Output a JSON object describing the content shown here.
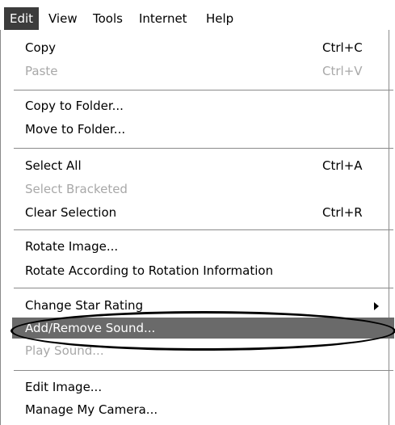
{
  "menubar": {
    "items": [
      "Edit",
      "View",
      "Tools",
      "Internet",
      "Help"
    ],
    "active": "Edit"
  },
  "menu": {
    "copy": {
      "label": "Copy",
      "shortcut": "Ctrl+C"
    },
    "paste": {
      "label": "Paste",
      "shortcut": "Ctrl+V"
    },
    "copy_to_folder": {
      "label": "Copy to Folder..."
    },
    "move_to_folder": {
      "label": "Move to Folder..."
    },
    "select_all": {
      "label": "Select All",
      "shortcut": "Ctrl+A"
    },
    "select_bracketed": {
      "label": "Select Bracketed"
    },
    "clear_selection": {
      "label": "Clear Selection",
      "shortcut": "Ctrl+R"
    },
    "rotate_image": {
      "label": "Rotate Image..."
    },
    "rotate_by_info": {
      "label": "Rotate According to Rotation Information"
    },
    "change_star_rating": {
      "label": "Change Star Rating"
    },
    "add_remove_sound": {
      "label": "Add/Remove Sound..."
    },
    "play_sound": {
      "label": "Play Sound..."
    },
    "edit_image": {
      "label": "Edit Image..."
    },
    "manage_camera": {
      "label": "Manage My Camera..."
    }
  },
  "icons": {
    "submenu_arrow": "chevron-right-icon",
    "highlight_callout": "oval-callout"
  },
  "colors": {
    "active_menu_bg": "#3c3c3c",
    "highlight_bg": "#6a6a6a",
    "disabled_text": "#a8a8a8"
  }
}
